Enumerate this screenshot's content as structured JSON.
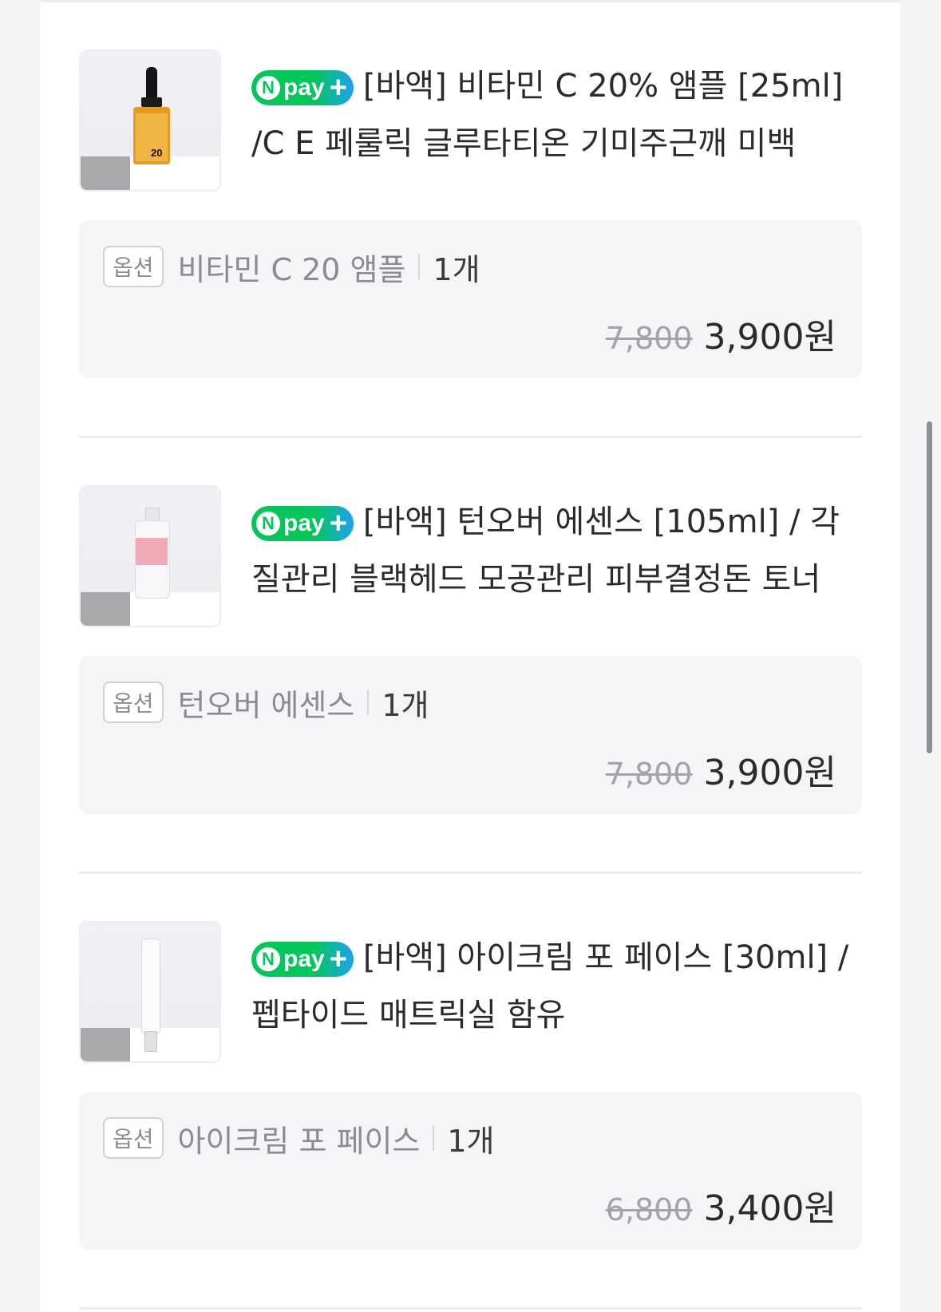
{
  "products": [
    {
      "badge": "Npay+",
      "title": "[바액] 비타민 C 20% 앰플 [25ml] /C E 페룰릭 글루타티온 기미주근깨 미백",
      "thumbnail_icon": "vitamin-c-ampoule-bottle",
      "option_tag": "옵션",
      "option_name": "비타민 C 20 앰플",
      "quantity": "1개",
      "original_price": "7,800",
      "final_price": "3,900원"
    },
    {
      "badge": "Npay+",
      "title": "[바액] 턴오버 에센스 [105ml] / 각질관리 블랙헤드 모공관리 피부결정돈 토너",
      "thumbnail_icon": "turnover-essence-bottle",
      "option_tag": "옵션",
      "option_name": "턴오버 에센스",
      "quantity": "1개",
      "original_price": "7,800",
      "final_price": "3,900원"
    },
    {
      "badge": "Npay+",
      "title": "[바액] 아이크림 포 페이스 [30ml] /펩타이드 매트릭실 함유",
      "thumbnail_icon": "eye-cream-tube",
      "option_tag": "옵션",
      "option_name": "아이크림 포 페이스",
      "quantity": "1개",
      "original_price": "6,800",
      "final_price": "3,400원"
    }
  ],
  "colors": {
    "npay_green": "#03c75a",
    "npay_blue": "#1ea1f2",
    "option_bg": "#f4f5f7",
    "page_bg": "#f2f3f5"
  }
}
